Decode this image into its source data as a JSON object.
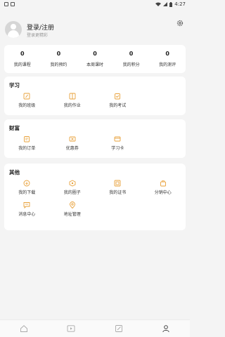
{
  "status_bar": {
    "time": "4:27"
  },
  "profile": {
    "title": "登录/注册",
    "subtitle": "登录更精彩"
  },
  "stats": [
    {
      "value": "0",
      "label": "我的课程"
    },
    {
      "value": "0",
      "label": "我的预约"
    },
    {
      "value": "0",
      "label": "本周课时"
    },
    {
      "value": "0",
      "label": "我的积分"
    },
    {
      "value": "0",
      "label": "我的测评"
    }
  ],
  "study": {
    "title": "学习",
    "items": [
      {
        "label": "我的班级",
        "icon": "class-icon"
      },
      {
        "label": "我的作业",
        "icon": "homework-icon"
      },
      {
        "label": "我的考试",
        "icon": "exam-icon"
      }
    ]
  },
  "wealth": {
    "title": "财富",
    "items": [
      {
        "label": "我的订单",
        "icon": "order-icon"
      },
      {
        "label": "优惠券",
        "icon": "coupon-icon"
      },
      {
        "label": "学习卡",
        "icon": "card-icon"
      }
    ]
  },
  "other": {
    "title": "其他",
    "items": [
      {
        "label": "我的下载",
        "icon": "download-icon"
      },
      {
        "label": "我的圈子",
        "icon": "circle-icon"
      },
      {
        "label": "我的证书",
        "icon": "certificate-icon"
      },
      {
        "label": "分销中心",
        "icon": "distribution-icon"
      },
      {
        "label": "消息中心",
        "icon": "message-icon"
      },
      {
        "label": "地址管理",
        "icon": "address-icon"
      }
    ]
  },
  "colors": {
    "accent": "#e8a13a",
    "background": "#f4f4f4",
    "card": "#ffffff"
  },
  "tabbar": [
    {
      "icon": "home-icon"
    },
    {
      "icon": "video-icon"
    },
    {
      "icon": "edit-icon"
    },
    {
      "icon": "profile-icon",
      "active": true
    }
  ]
}
